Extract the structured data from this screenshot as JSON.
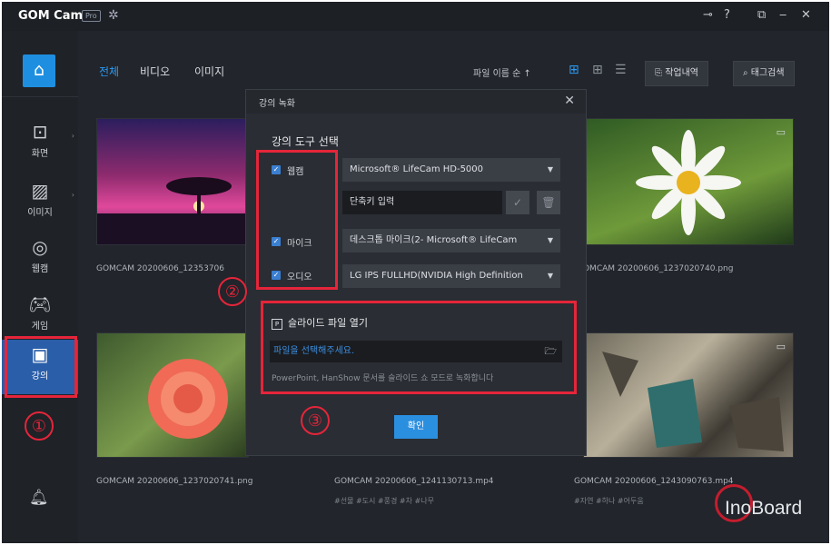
{
  "app": {
    "logo": "GOM Cam",
    "badge": "Pro"
  },
  "titlebar": {
    "key_icon": "⊸",
    "help": "?",
    "restore": "⧉",
    "minimize": "‒",
    "close": "✕"
  },
  "sidebar": {
    "items": [
      {
        "label": "화면",
        "icon": "screen-icon"
      },
      {
        "label": "이미지",
        "icon": "image-icon"
      },
      {
        "label": "웹캠",
        "icon": "webcam-icon"
      },
      {
        "label": "게임",
        "icon": "gamepad-icon"
      },
      {
        "label": "강의",
        "icon": "lecture-icon",
        "active": true
      }
    ]
  },
  "main": {
    "tabs": [
      "전체",
      "비디오",
      "이미지"
    ],
    "sort": "파일 이름 순 ↑",
    "task_history": "작업내역",
    "tag_search": "태그검색",
    "files": [
      {
        "name": "GOMCAM 20200606_12353706",
        "tags": ""
      },
      {
        "name": "",
        "tags": ""
      },
      {
        "name": "GOMCAM 20200606_1237020740.png",
        "tags": ""
      },
      {
        "name": "GOMCAM 20200606_1237020741.png",
        "tags": ""
      },
      {
        "name": "GOMCAM 20200606_1241130713.mp4",
        "tags": "#선물 #도시 #풍경 #차 #나무"
      },
      {
        "name": "GOMCAM 20200606_1243090763.mp4",
        "tags": "#자연 #하나 #어두움"
      }
    ]
  },
  "dialog": {
    "title": "강의 녹화",
    "section_title": "강의 도구 선택",
    "webcam": {
      "label": "웹캠",
      "value": "Microsoft® LifeCam HD-5000"
    },
    "shortcut_placeholder": "단축키 입력",
    "mic": {
      "label": "마이크",
      "value": "데스크톱 마이크(2- Microsoft® LifeCam"
    },
    "audio": {
      "label": "오디오",
      "value": "LG IPS FULLHD(NVIDIA High Definition"
    },
    "slide_title": "슬라이드 파일 열기",
    "ppt_badge": "P",
    "file_placeholder": "파일을 선택해주세요.",
    "description": "PowerPoint, HanShow 문서를 슬라이드 쇼 모드로 녹화합니다",
    "ok_label": "확인"
  },
  "annotations": {
    "step1": "①",
    "step2": "②",
    "step3": "③"
  },
  "watermark": {
    "text": "InoBoard"
  }
}
